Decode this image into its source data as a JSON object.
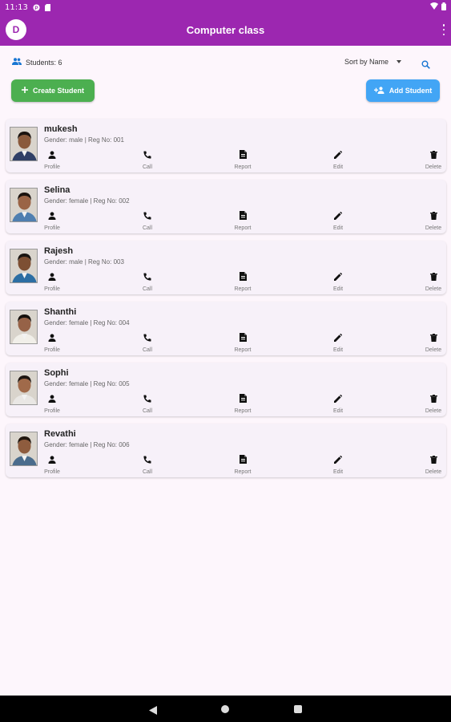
{
  "status_bar": {
    "time": "11:13"
  },
  "app_bar": {
    "avatar_letter": "D",
    "title": "Computer class"
  },
  "toolbar": {
    "students_count": "Students: 6",
    "sort_label": "Sort by Name",
    "create_label": "Create Student",
    "add_label": "Add Student"
  },
  "actions": {
    "profile": "Profile",
    "call": "Call",
    "report": "Report",
    "edit": "Edit",
    "delete": "Delete"
  },
  "students": [
    {
      "name": "mukesh",
      "meta": "Gender: male | Reg No: 001"
    },
    {
      "name": "Selina",
      "meta": "Gender: female | Reg No: 002"
    },
    {
      "name": "Rajesh",
      "meta": "Gender: male | Reg No: 003"
    },
    {
      "name": "Shanthi",
      "meta": "Gender: female | Reg No: 004"
    },
    {
      "name": "Sophi",
      "meta": "Gender: female | Reg No: 005"
    },
    {
      "name": "Revathi",
      "meta": "Gender: female | Reg No: 006"
    }
  ],
  "colors": {
    "app_bar": "#9c27b0",
    "create_button": "#4caf50",
    "add_button": "#42a5f5",
    "background": "#fdf6fc"
  }
}
